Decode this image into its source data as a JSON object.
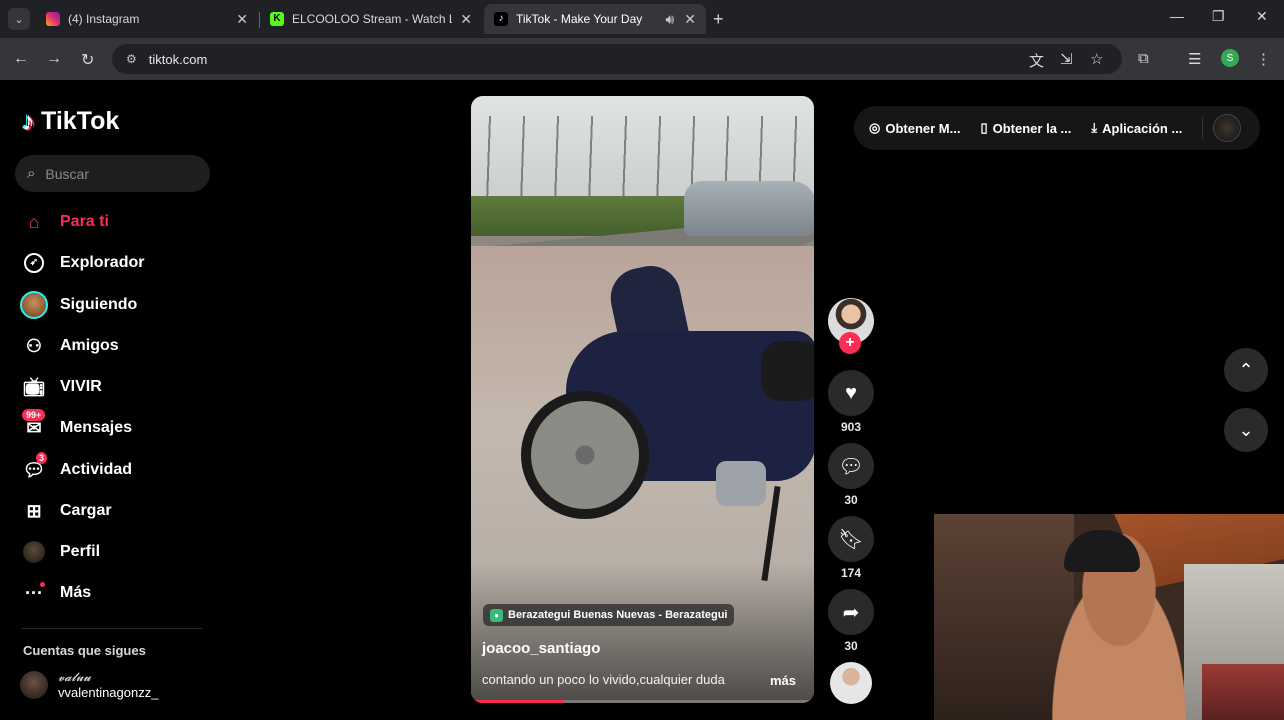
{
  "browser": {
    "tabs": [
      {
        "title": "(4) Instagram",
        "favicon_color": "#e1306c"
      },
      {
        "title": "ELCOOLOO Stream - Watch Live",
        "favicon_color": "#53fc18"
      },
      {
        "title": "TikTok - Make Your Day",
        "favicon_color": "#111111"
      }
    ],
    "url": "tiktok.com",
    "profile_initial": "S"
  },
  "sidebar": {
    "logo_text": "TikTok",
    "search_placeholder": "Buscar",
    "nav": [
      {
        "label": "Para ti",
        "icon": "home-icon",
        "active": true
      },
      {
        "label": "Explorador",
        "icon": "compass-icon"
      },
      {
        "label": "Siguiendo",
        "icon": "following-avatar"
      },
      {
        "label": "Amigos",
        "icon": "friends-icon"
      },
      {
        "label": "VIVIR",
        "icon": "live-tv-icon"
      },
      {
        "label": "Mensajes",
        "icon": "messages-icon",
        "badge": "99+"
      },
      {
        "label": "Actividad",
        "icon": "activity-icon",
        "badge": "3"
      },
      {
        "label": "Cargar",
        "icon": "upload-icon"
      },
      {
        "label": "Perfil",
        "icon": "profile-avatar"
      },
      {
        "label": "Más",
        "icon": "more-icon"
      }
    ],
    "following_title": "Cuentas que sigues",
    "following": [
      {
        "display": "𝓿𝓪𝓵𝓾𝓾",
        "username": "vvalentinagonzz_"
      }
    ]
  },
  "video": {
    "location": "Berazategui Buenas Nuevas - Berazategui",
    "author": "joacoo_santiago",
    "caption": "contando un poco lo vivido,cualquier duda",
    "more_label": "más",
    "progress": 0.27
  },
  "actions": {
    "likes": "903",
    "comments": "30",
    "saves": "174",
    "shares": "30"
  },
  "top_pill": {
    "items": [
      {
        "label": "Obtener M...",
        "icon": "coin-icon"
      },
      {
        "label": "Obtener la ...",
        "icon": "phone-icon"
      },
      {
        "label": "Aplicación ...",
        "icon": "download-icon"
      }
    ]
  },
  "colors": {
    "accent": "#fe2c55",
    "cyan": "#25f4ee",
    "background": "#000000"
  }
}
